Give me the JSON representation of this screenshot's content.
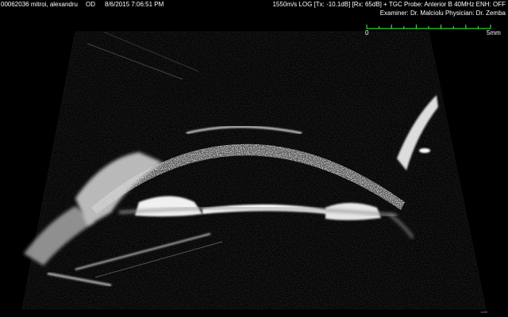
{
  "header": {
    "patient": "00062036 mitroi, alexandru",
    "eye": "OD",
    "datetime": "8/6/2015 7:06:51 PM",
    "params": "1550m/s LOG [Tx: -10.1dB] [Rx: 65dB] + TGC Probe: Anterior B 40MHz ENH: OFF",
    "examiners": "Examiner: Dr. Malciolu  Physician: Dr. Zemba"
  },
  "scale": {
    "start_label": "0",
    "end_label": "5mm",
    "color": "#3cff3c"
  },
  "corner_label": "1x85",
  "colors": {
    "background": "#000000",
    "text": "#ffffff"
  }
}
